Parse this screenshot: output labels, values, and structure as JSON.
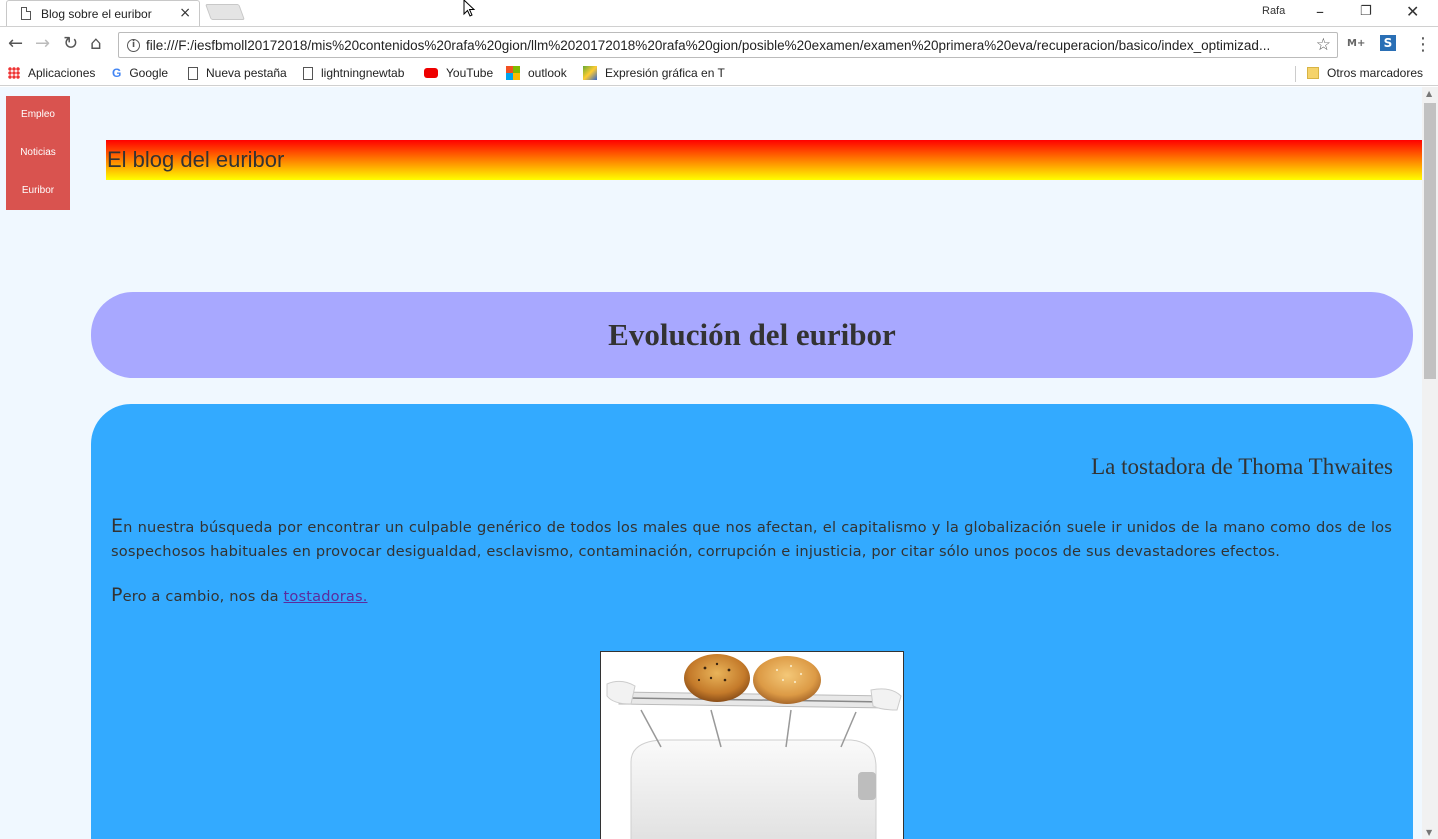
{
  "browser": {
    "tab_title": "Blog sobre el euribor",
    "tab_close": "×",
    "profile_name": "Rafa",
    "url": "file:///F:/iesfbmoll20172018/mis%20contenidos%20rafa%20gion/llm%2020172018%20rafa%20gion/posible%20examen/examen%20primera%20eva/recuperacion/basico/index_optimizad...",
    "ext_label": "M+",
    "bookmarks": {
      "apps": "Aplicaciones",
      "google": "Google",
      "new_tab": "Nueva pestaña",
      "lightning": "lightningnewtab",
      "youtube": "YouTube",
      "outlook": "outlook",
      "expresion": "Expresión gráfica en T",
      "other": "Otros marcadores"
    }
  },
  "page": {
    "nav": [
      "Empleo",
      "Noticias",
      "Euribor"
    ],
    "site_title": "El blog del euribor",
    "heading": "Evolución del euribor",
    "article": {
      "subtitle": "La tostadora de Thoma Thwaites",
      "p1_cap": "E",
      "p1_rest": "n nuestra búsqueda por encontrar un culpable genérico de todos los males que nos afectan, el capitalismo y la globalización suele ir unidos de la mano como dos de los sospechosos habituales en provocar desigualdad, esclavismo, contaminación, corrupción e injusticia, por citar sólo unos pocos de sus devastadores efectos.",
      "p2_cap": "P",
      "p2_rest": "ero a cambio, nos da ",
      "p2_link": "tostadoras."
    }
  },
  "colors": {
    "page_bg": "#f0f8ff",
    "nav_bg": "#d9534f",
    "title_box": "#a8a8ff",
    "article_bg": "#33aaff"
  }
}
